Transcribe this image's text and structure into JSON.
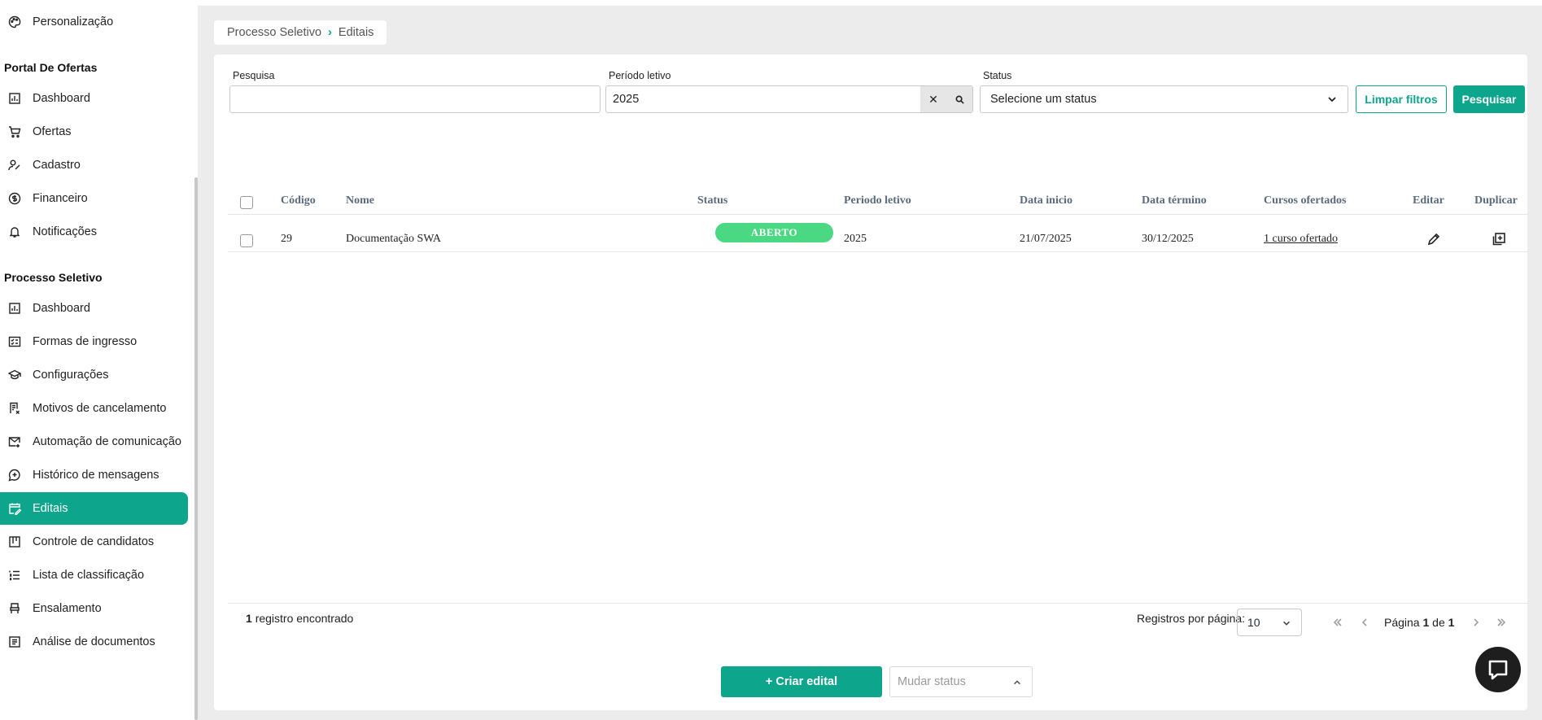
{
  "sidebar": {
    "top_item": "Personalização",
    "sections": [
      {
        "title": "Portal De Ofertas",
        "items": [
          "Dashboard",
          "Ofertas",
          "Cadastro",
          "Financeiro",
          "Notificações"
        ]
      },
      {
        "title": "Processo Seletivo",
        "items": [
          "Dashboard",
          "Formas de ingresso",
          "Configurações",
          "Motivos de cancelamento",
          "Automação de comunicação",
          "Histórico de mensagens",
          "Editais",
          "Controle de candidatos",
          "Lista de classificação",
          "Ensalamento",
          "Análise de documentos"
        ]
      }
    ],
    "active_item": "Editais"
  },
  "breadcrumb": {
    "parent": "Processo Seletivo",
    "current": "Editais"
  },
  "filters": {
    "search_label": "Pesquisa",
    "search_value": "",
    "period_label": "Período letivo",
    "period_value": "2025",
    "status_label": "Status",
    "status_placeholder": "Selecione um status",
    "clear_button": "Limpar filtros",
    "search_button": "Pesquisar"
  },
  "table": {
    "headers": [
      "Código",
      "Nome",
      "Status",
      "Periodo letivo",
      "Data inicio",
      "Data término",
      "Cursos ofertados",
      "Editar",
      "Duplicar"
    ],
    "rows": [
      {
        "code": "29",
        "name": "Documentação SWA",
        "status": "ABERTO",
        "period": "2025",
        "start": "21/07/2025",
        "end": "30/12/2025",
        "courses": "1 curso ofertado"
      }
    ]
  },
  "footer": {
    "count": "1",
    "count_label": "registro encontrado",
    "per_page_label": "Registros por página:",
    "per_page_value": "10",
    "page_prefix": "Página",
    "page_current": "1",
    "page_of": "de",
    "page_total": "1"
  },
  "actions": {
    "create_button": "+ Criar edital",
    "status_placeholder": "Mudar status"
  },
  "colors": {
    "accent": "#0ea58d",
    "status_open": "#4bd882"
  }
}
